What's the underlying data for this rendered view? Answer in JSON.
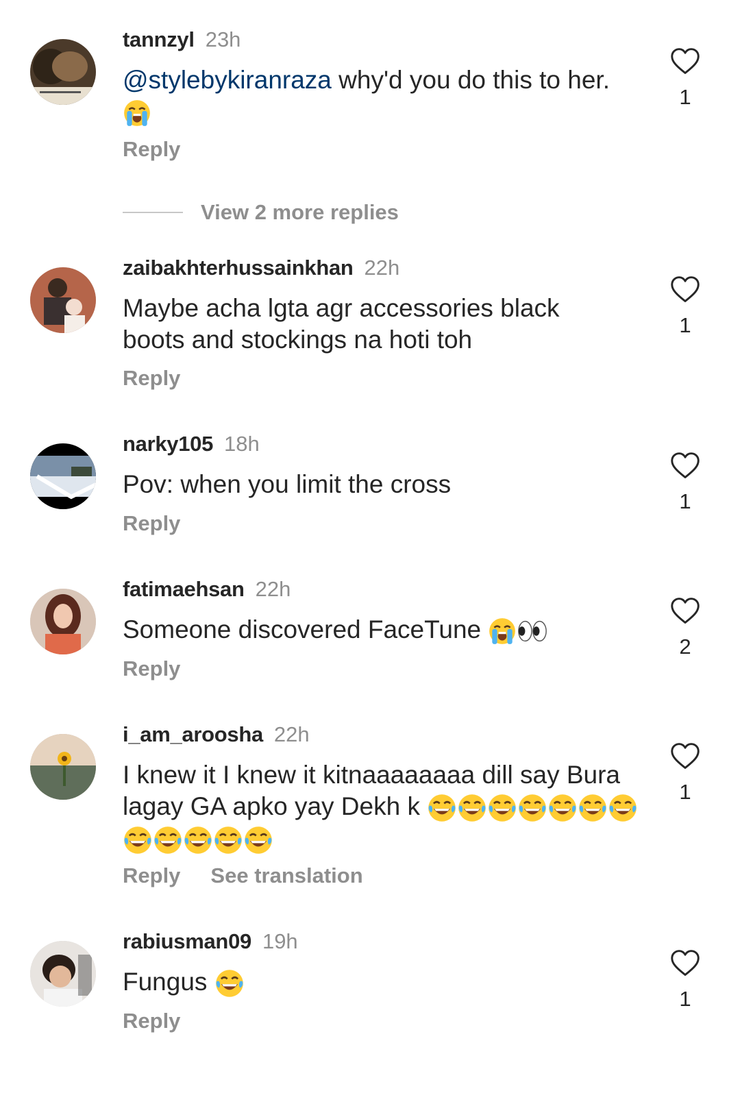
{
  "comments": [
    {
      "username": "tannzyl",
      "time": "23h",
      "mention": "@stylebykiranraza",
      "text": " why'd you do this to her.",
      "emojis": [
        "loudly-crying"
      ],
      "reply": "Reply",
      "likes": "1"
    },
    {
      "username": "zaibakhterhussainkhan",
      "time": "22h",
      "text": "Maybe acha lgta agr accessories black boots and stockings na hoti toh",
      "reply": "Reply",
      "likes": "1"
    },
    {
      "username": "narky105",
      "time": "18h",
      "text": "Pov: when you limit the cross",
      "reply": "Reply",
      "likes": "1"
    },
    {
      "username": "fatimaehsan",
      "time": "22h",
      "text": "Someone discovered FaceTune",
      "emojis": [
        "loudly-crying",
        "eyes"
      ],
      "reply": "Reply",
      "likes": "2"
    },
    {
      "username": "i_am_aroosha",
      "time": "22h",
      "text": "I knew it I knew it kitnaaaaaaaa dill say Bura lagay GA apko yay Dekh k",
      "emojis": [
        "tears-of-joy x12"
      ],
      "reply": "Reply",
      "see_translation": "See translation",
      "likes": "1"
    },
    {
      "username": "rabiusman09",
      "time": "19h",
      "text": "Fungus",
      "emojis": [
        "tears-of-joy"
      ],
      "reply": "Reply",
      "likes": "1"
    }
  ],
  "view_more_replies": "View 2 more replies",
  "colors": {
    "text": "#262626",
    "secondary": "#8e8e8e",
    "mention": "#00376b",
    "divider": "#c7c7c7"
  }
}
